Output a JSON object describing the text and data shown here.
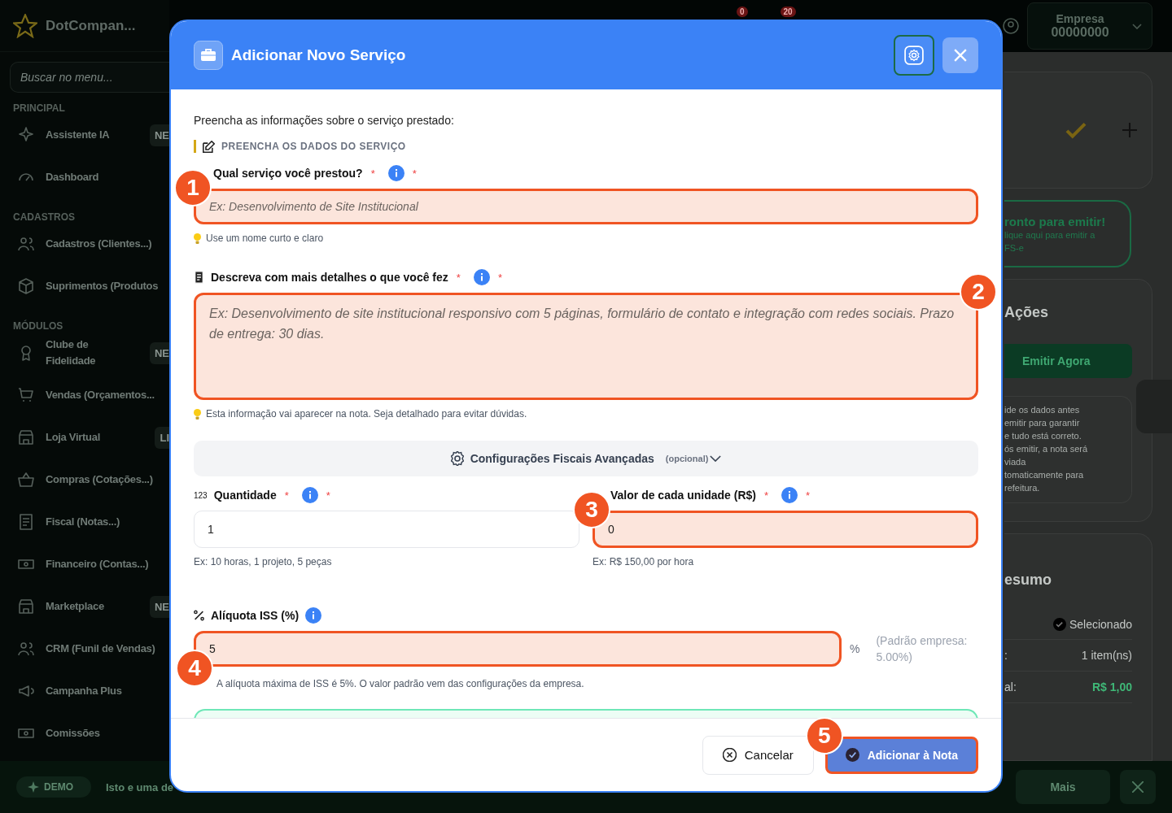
{
  "sidebar": {
    "logo": "DotCompan...",
    "search_placeholder": "Buscar no menu...",
    "sections": [
      {
        "title": "PRINCIPAL",
        "items": [
          {
            "label": "Assistente IA",
            "badge": "NE"
          },
          {
            "label": "Dashboard"
          }
        ]
      },
      {
        "title": "CADASTROS",
        "items": [
          {
            "label": "Cadastros (Clientes...)"
          },
          {
            "label": "Suprimentos (Produtos"
          }
        ]
      },
      {
        "title": "MÓDULOS",
        "items": [
          {
            "label": "Clube de Fidelidade",
            "badge": "NE"
          },
          {
            "label": "Vendas (Orçamentos..."
          },
          {
            "label": "Loja Virtual",
            "badge": "LI"
          },
          {
            "label": "Compras (Cotações...)"
          },
          {
            "label": "Fiscal (Notas...)"
          },
          {
            "label": "Financeiro (Contas...)"
          },
          {
            "label": "Marketplace",
            "badge": "NE"
          },
          {
            "label": "CRM (Funil de Vendas)"
          },
          {
            "label": "Campanha Plus"
          },
          {
            "label": "Comissões"
          }
        ]
      }
    ]
  },
  "topbar": {
    "notifications": [
      "0",
      "20"
    ],
    "account": {
      "name": "Empresa",
      "number": "00000000"
    }
  },
  "panel": {
    "ready": {
      "title": "ronto para emitir!",
      "lines": [
        "lique aqui para emitir a",
        "FS-e"
      ]
    },
    "actions": {
      "title": "Ações",
      "button": "Emitir Agora",
      "info_lines": [
        "ide os dados antes",
        "emitir para garantir",
        "e tudo está correto.",
        "ós emitir, a nota será",
        "viada",
        "tomaticamente para",
        "refeitura."
      ]
    },
    "summary": {
      "title": "esumo",
      "status": "Selecionado",
      "rows": [
        {
          "label": ":",
          "value": "1 item(ns)"
        },
        {
          "label": "al:",
          "value": "R$ 1,00"
        }
      ]
    }
  },
  "bottom_bar": {
    "demo": "DEMO",
    "message": "Isto e uma de",
    "more": "Mais"
  },
  "modal": {
    "title": "Adicionar Novo Serviço",
    "intro": "Preencha as informações sobre o serviço prestado:",
    "section": "PREENCHA OS DADOS DO SERVIÇO",
    "fields": [
      {
        "kind": "text",
        "label": "Qual serviço você prestou?",
        "required": "*",
        "info": true,
        "info_mark": "*",
        "placeholder": "Ex: Desenvolvimento de Site Institucional",
        "hint": "Use um nome curto e claro",
        "tip": true,
        "highlighted": true,
        "marker": "1"
      },
      {
        "kind": "textarea",
        "label": "Descreva com mais detalhes o que você fez",
        "required": "*",
        "info": true,
        "info_mark": "*",
        "placeholder": "Ex: Desenvolvimento de site institucional responsivo com 5 páginas, formulário de contato e integração com redes sociais. Prazo de entrega: 30 dias.",
        "hint": "Esta informação vai aparecer na nota. Seja detalhado para evitar dúvidas.",
        "tip": true,
        "highlighted": true,
        "marker": "2"
      }
    ],
    "advanced": {
      "label": "Configurações Fiscais Avançadas",
      "note": "(opcional)",
      "expanded": false
    },
    "pair": [
      {
        "icon_text": "123",
        "label": "Quantidade",
        "required": "*",
        "info": true,
        "info_mark": "*",
        "value": "1",
        "hint": "Ex: 10 horas, 1 projeto, 5 peças",
        "highlighted": false
      },
      {
        "label": "Valor de cada unidade (R$)",
        "required": "*",
        "info": true,
        "info_mark": "*",
        "value": "0",
        "hint": "Ex: R$ 150,00 por hora",
        "highlighted": true,
        "marker": "3"
      }
    ],
    "iss": {
      "label": "Alíquota ISS (%)",
      "info": true,
      "value": "5",
      "unit": "%",
      "default_note": "(Padrão empresa: 5.00%)",
      "hint": "A alíquota máxima de ISS é 5%. O valor padrão vem das configurações da empresa.",
      "highlighted": true,
      "marker": "4"
    },
    "buttons": [
      {
        "kind": "cancel",
        "label": "Cancelar",
        "highlighted": false
      },
      {
        "kind": "confirm",
        "label": "Adicionar à Nota",
        "highlighted": true,
        "marker": "5"
      }
    ]
  }
}
